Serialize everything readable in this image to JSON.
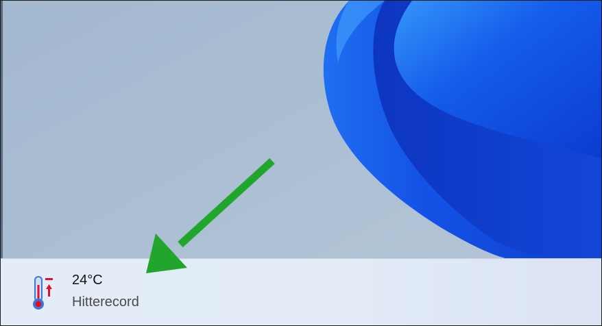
{
  "weather": {
    "temperature": "24°C",
    "condition": "Hitterecord",
    "icon": "thermometer-heat-icon"
  },
  "colors": {
    "wallpaper_gray": "#a9bdd2",
    "wallpaper_blue": "#1a4fe0",
    "taskbar": "#e2ebf6",
    "arrow": "#22a52c",
    "heat_red": "#e0102a",
    "thermo_blue": "#3a78d8"
  }
}
